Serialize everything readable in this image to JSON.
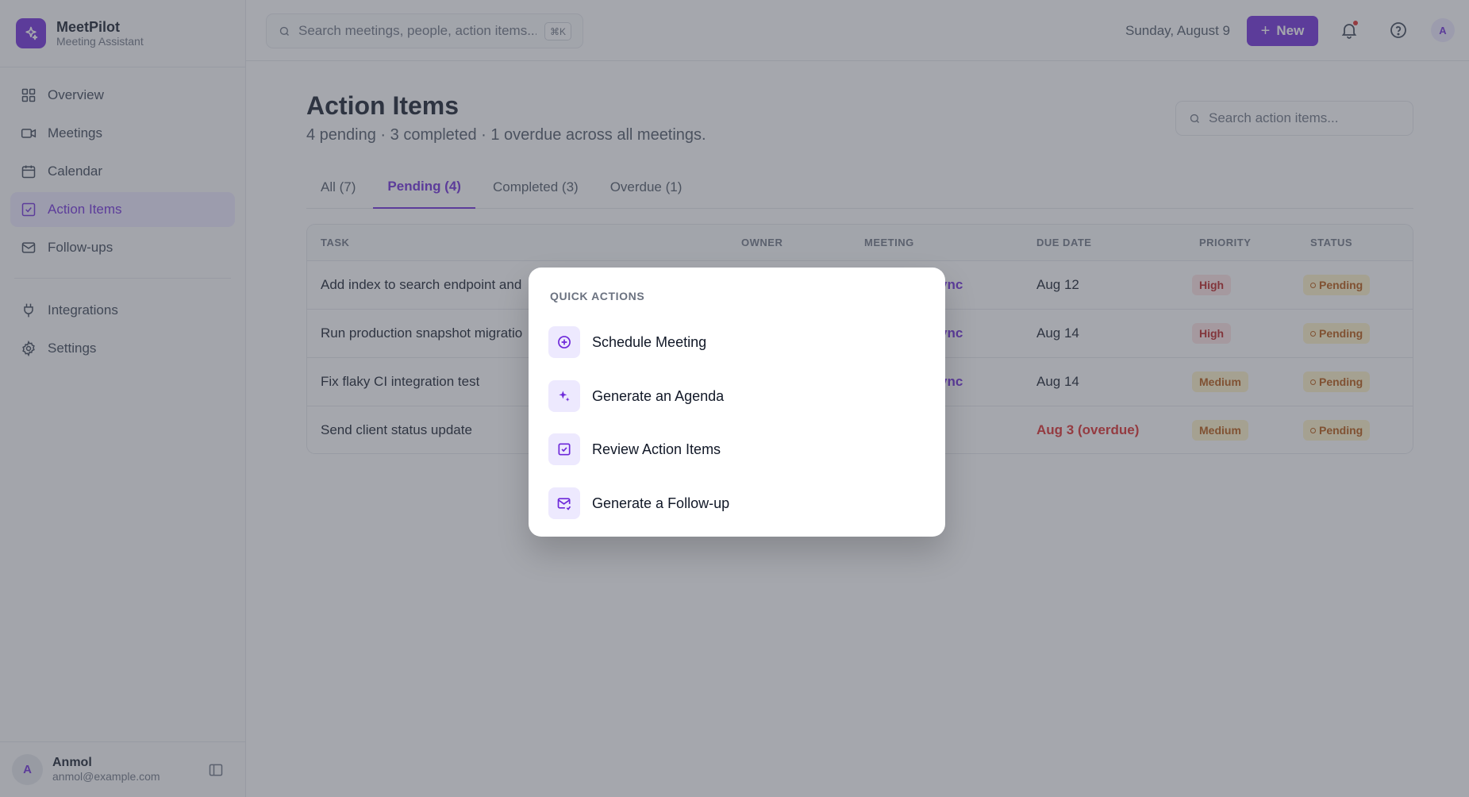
{
  "brand": {
    "name": "MeetPilot",
    "subtitle": "Meeting Assistant",
    "logo_icon": "sparkles-icon"
  },
  "sidebar": {
    "items": [
      {
        "label": "Overview",
        "icon": "grid-icon",
        "active": false
      },
      {
        "label": "Meetings",
        "icon": "video-icon",
        "active": false
      },
      {
        "label": "Calendar",
        "icon": "calendar-icon",
        "active": false
      },
      {
        "label": "Action Items",
        "icon": "check-square-icon",
        "active": true
      },
      {
        "label": "Follow-ups",
        "icon": "mail-icon",
        "active": false
      }
    ],
    "secondary_items": [
      {
        "label": "Integrations",
        "icon": "plug-icon"
      },
      {
        "label": "Settings",
        "icon": "gear-icon"
      }
    ],
    "user": {
      "initial": "A",
      "name": "Anmol",
      "email": "anmol@example.com"
    }
  },
  "header": {
    "search_placeholder": "Search meetings, people, action items...",
    "shortcut": "⌘K",
    "date": "Sunday, August 9",
    "new_label": "New",
    "avatar_initial": "A"
  },
  "page": {
    "title": "Action Items",
    "subtitle": "4 pending · 3 completed · 1 overdue across all meetings.",
    "search_placeholder": "Search action items..."
  },
  "tabs": [
    {
      "label": "All (7)",
      "active": false
    },
    {
      "label": "Pending (4)",
      "active": true
    },
    {
      "label": "Completed (3)",
      "active": false
    },
    {
      "label": "Overdue (1)",
      "active": false
    }
  ],
  "table": {
    "columns": [
      "TASK",
      "OWNER",
      "MEETING",
      "DUE DATE",
      "PRIORITY",
      "STATUS"
    ],
    "rows": [
      {
        "task": "Add index to search endpoint and",
        "meeting": "ync",
        "due": "Aug 12",
        "overdue": false,
        "priority": "High",
        "status": "Pending"
      },
      {
        "task": "Run production snapshot migratio",
        "meeting": "ync",
        "due": "Aug 14",
        "overdue": false,
        "priority": "High",
        "status": "Pending"
      },
      {
        "task": "Fix flaky CI integration test",
        "meeting": "ync",
        "due": "Aug 14",
        "overdue": false,
        "priority": "Medium",
        "status": "Pending"
      },
      {
        "task": "Send client status update",
        "meeting": "",
        "due": "Aug 3 (overdue)",
        "overdue": true,
        "priority": "Medium",
        "status": "Pending"
      }
    ]
  },
  "quick_actions": {
    "heading": "QUICK ACTIONS",
    "items": [
      {
        "label": "Schedule Meeting",
        "icon": "plus-circle-icon"
      },
      {
        "label": "Generate an Agenda",
        "icon": "sparkles-icon"
      },
      {
        "label": "Review Action Items",
        "icon": "check-square-icon"
      },
      {
        "label": "Generate a Follow-up",
        "icon": "mail-send-icon"
      }
    ]
  },
  "colors": {
    "accent": "#6d28d9",
    "danger": "#dc2626",
    "warning": "#b45309"
  }
}
